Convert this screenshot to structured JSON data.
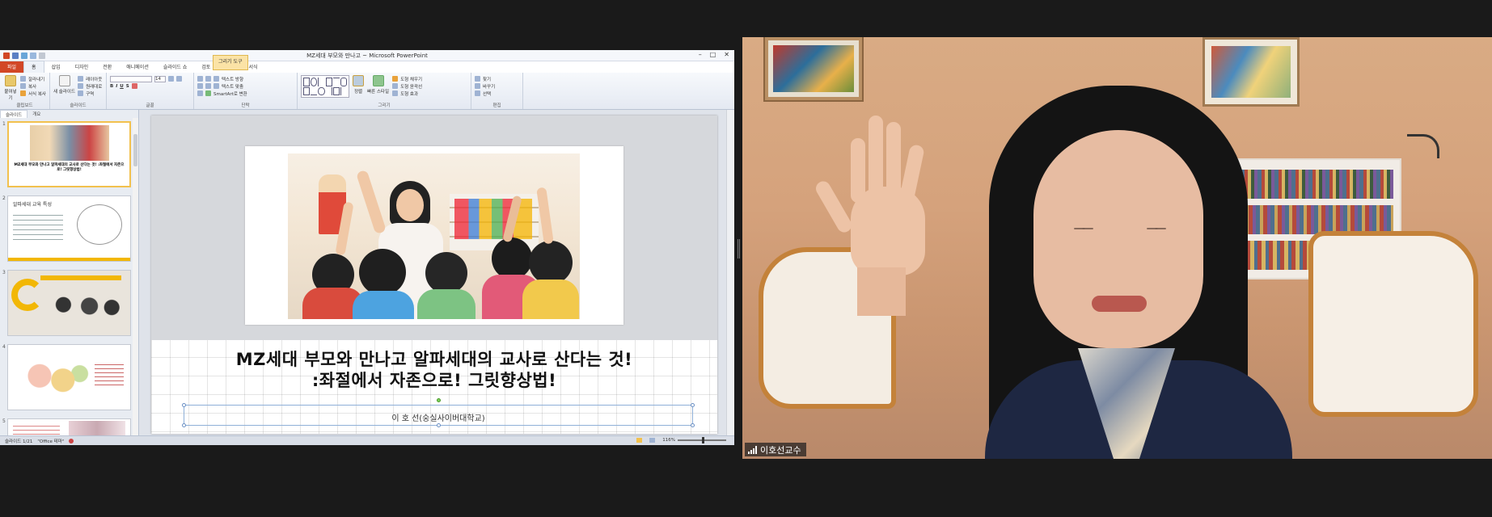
{
  "powerpoint": {
    "window_title": "MZ세대 부모와 만나고 ~ Microsoft PowerPoint",
    "window_controls": [
      "–",
      "□",
      "✕"
    ],
    "tabs": [
      "파일",
      "홈",
      "삽입",
      "디자인",
      "전환",
      "애니메이션",
      "슬라이드 쇼",
      "검토",
      "보기",
      "서식"
    ],
    "context_tab": "그리기 도구",
    "ribbon": {
      "clipboard": {
        "paste": "붙여넣기",
        "cut": "잘라내기",
        "copy": "복사",
        "format_painter": "서식 복사",
        "group": "클립보드"
      },
      "slides": {
        "new_slide": "새 슬라이드",
        "layout": "레이아웃",
        "reset": "원래대로",
        "section": "구역",
        "group": "슬라이드"
      },
      "font": {
        "size": "14",
        "group": "글꼴"
      },
      "paragraph": {
        "text_direction": "텍스트 방향",
        "align_text": "텍스트 맞춤",
        "smartart": "SmartArt로 변환",
        "group": "단락"
      },
      "drawing": {
        "arrange": "정렬",
        "quick_styles": "빠른 스타일",
        "shape_fill": "도형 채우기",
        "shape_outline": "도형 윤곽선",
        "shape_effects": "도형 효과",
        "group": "그리기"
      },
      "editing": {
        "find": "찾기",
        "replace": "바꾸기",
        "select": "선택",
        "group": "편집"
      }
    },
    "panel_tabs": [
      "슬라이드",
      "개요"
    ],
    "thumbnails": [
      {
        "num": "1",
        "caption": "MZ세대 부모와 만나고 알파세대의 교사로 산다는 것! :좌절에서 자존으로! 그릿향상법!"
      },
      {
        "num": "2",
        "caption": "알파세대 교육 특성"
      },
      {
        "num": "3",
        "caption": ""
      },
      {
        "num": "4",
        "caption": ""
      },
      {
        "num": "5",
        "caption": ""
      }
    ],
    "slide": {
      "headline_line1": "MZ세대 부모와 만나고 알파세대의 교사로 산다는 것!",
      "headline_line2": ":좌절에서 자존으로! 그릿향상법!",
      "author": "이 호 선(숭실사이버대학교)"
    },
    "status": {
      "slide_info": "슬라이드 1/21",
      "theme": "\"Office 테마\"",
      "zoom": "116%"
    }
  },
  "video": {
    "participant_name": "이호선교수"
  },
  "colors": {
    "file_tab": "#d24726",
    "context_tab": "#fbe3a6",
    "video_wall": "#d5a27c",
    "bookshelf": "#f1ece6"
  }
}
